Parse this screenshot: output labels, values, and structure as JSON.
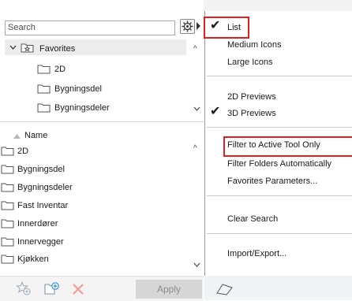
{
  "search": {
    "placeholder": "Search"
  },
  "tree": {
    "favorites_label": "Favorites",
    "children": [
      "2D",
      "Bygningsdel",
      "Bygningsdeler"
    ]
  },
  "list": {
    "header": "Name",
    "items": [
      "2D",
      "Bygningsdel",
      "Bygningsdeler",
      "Fast Inventar",
      "Innerdører",
      "Innervegger",
      "Kjøkken"
    ]
  },
  "bottom": {
    "apply_label": "Apply"
  },
  "menu": {
    "list": "List",
    "medium_icons": "Medium Icons",
    "large_icons": "Large Icons",
    "previews_2d": "2D Previews",
    "previews_3d": "3D Previews",
    "filter_active": "Filter to Active Tool Only",
    "filter_folders": "Filter Folders Automatically",
    "favorites_params": "Favorites Parameters...",
    "clear_search": "Clear Search",
    "import_export": "Import/Export..."
  },
  "colors": {
    "highlight_red": "#e0201e",
    "check": "#1a1a1a"
  },
  "icons": [
    "gear-icon",
    "star-folder-icon",
    "folder-icon",
    "add-favorite-icon",
    "new-folder-icon",
    "delete-icon",
    "check-icon"
  ]
}
